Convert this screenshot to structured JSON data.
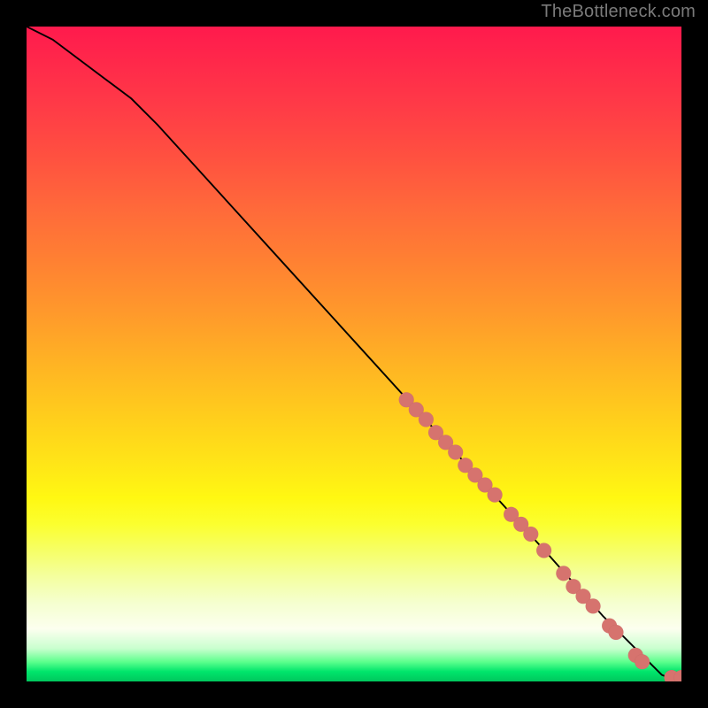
{
  "attribution": "TheBottleneck.com",
  "chart_data": {
    "type": "line",
    "title": "",
    "xlabel": "",
    "ylabel": "",
    "xlim": [
      0,
      100
    ],
    "ylim": [
      0,
      100
    ],
    "series": [
      {
        "name": "curve",
        "x": [
          0,
          4,
          8,
          12,
          16,
          20,
          30,
          40,
          50,
          60,
          70,
          80,
          88,
          92,
          94,
          96,
          97,
          98,
          100
        ],
        "y": [
          100,
          98,
          95,
          92,
          89,
          85,
          74,
          63,
          52,
          41,
          30,
          19,
          10,
          6,
          4,
          2,
          1,
          0.6,
          0.6
        ]
      }
    ],
    "points": [
      {
        "x": 58,
        "y": 43
      },
      {
        "x": 59.5,
        "y": 41.5
      },
      {
        "x": 61,
        "y": 40
      },
      {
        "x": 62.5,
        "y": 38
      },
      {
        "x": 64,
        "y": 36.5
      },
      {
        "x": 65.5,
        "y": 35
      },
      {
        "x": 67,
        "y": 33
      },
      {
        "x": 68.5,
        "y": 31.5
      },
      {
        "x": 70,
        "y": 30
      },
      {
        "x": 71.5,
        "y": 28.5
      },
      {
        "x": 74,
        "y": 25.5
      },
      {
        "x": 75.5,
        "y": 24
      },
      {
        "x": 77,
        "y": 22.5
      },
      {
        "x": 79,
        "y": 20
      },
      {
        "x": 82,
        "y": 16.5
      },
      {
        "x": 83.5,
        "y": 14.5
      },
      {
        "x": 85,
        "y": 13
      },
      {
        "x": 86.5,
        "y": 11.5
      },
      {
        "x": 89,
        "y": 8.5
      },
      {
        "x": 90,
        "y": 7.5
      },
      {
        "x": 93,
        "y": 4
      },
      {
        "x": 94,
        "y": 3
      },
      {
        "x": 98.5,
        "y": 0.6
      },
      {
        "x": 100,
        "y": 0.6
      }
    ],
    "point_radius_domain": 1.15,
    "colors": {
      "curve": "#000000",
      "points": "#d6736e"
    }
  }
}
